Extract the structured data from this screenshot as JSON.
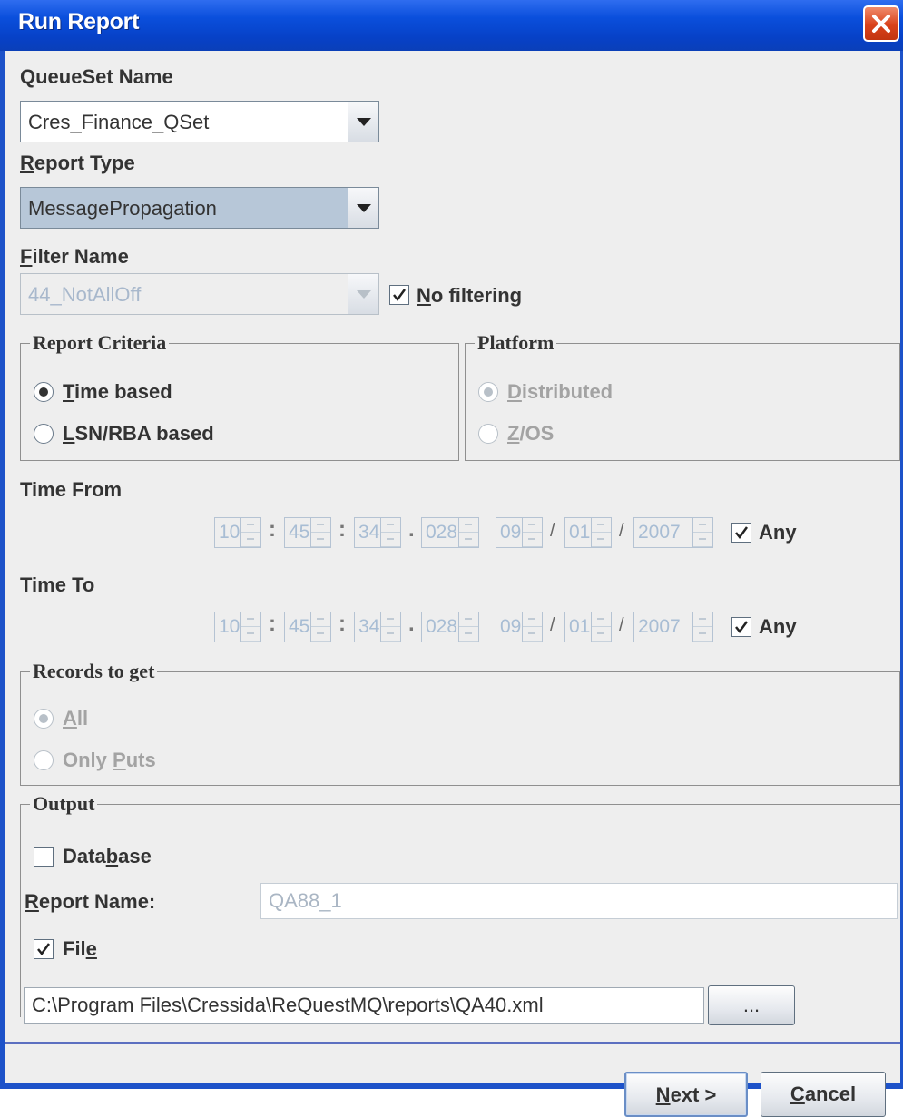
{
  "window": {
    "title": "Run Report"
  },
  "queueset": {
    "label": "QueueSet Name",
    "value": "Cres_Finance_QSet"
  },
  "report_type": {
    "label_u": "R",
    "label_rest": "eport Type",
    "value": "MessagePropagation"
  },
  "filter": {
    "label_u": "F",
    "label_rest": "ilter Name",
    "value": "44_NotAllOff",
    "no_filtering_u": "N",
    "no_filtering_rest": "o filtering"
  },
  "report_criteria": {
    "title": "Report Criteria",
    "time_u": "T",
    "time_rest": "ime based",
    "lsn_u": "L",
    "lsn_rest": "SN/RBA based"
  },
  "platform": {
    "title": "Platform",
    "dist_u": "D",
    "dist_rest": "istributed",
    "zos_u": "Z",
    "zos_rest": "/OS"
  },
  "time_from": {
    "label": "Time From",
    "hh": "10",
    "mm": "45",
    "ss": "34",
    "ms": "028",
    "month": "09",
    "day": "01",
    "year": "2007",
    "any": "Any"
  },
  "time_to": {
    "label": "Time To",
    "hh": "10",
    "mm": "45",
    "ss": "34",
    "ms": "028",
    "month": "09",
    "day": "01",
    "year": "2007",
    "any": "Any"
  },
  "separators": {
    "colon": ":",
    "dot": ".",
    "slash": "/"
  },
  "records": {
    "title": "Records to get",
    "all_u": "A",
    "all_rest": "ll",
    "puts_pre": "Only ",
    "puts_u": "P",
    "puts_rest": "uts"
  },
  "output": {
    "title": "Output",
    "db_pre": "Data",
    "db_u": "b",
    "db_rest": "ase",
    "report_name_u": "R",
    "report_name_rest": "eport Name:",
    "report_name_value": "QA88_1",
    "file_pre": "Fil",
    "file_u": "e",
    "file_path": "C:\\Program Files\\Cressida\\ReQuestMQ\\reports\\QA40.xml",
    "browse": "..."
  },
  "buttons": {
    "next_u": "N",
    "next_rest": "ext >",
    "cancel_u": "C",
    "cancel_rest": "ancel"
  }
}
